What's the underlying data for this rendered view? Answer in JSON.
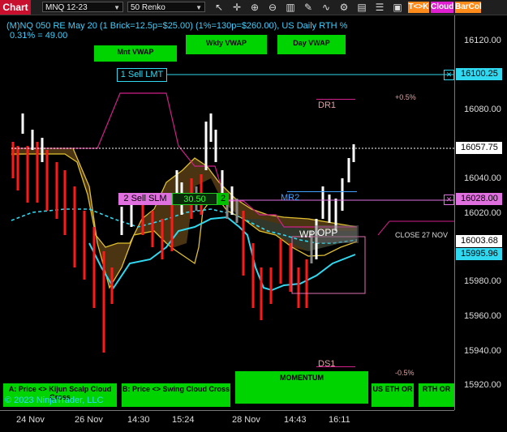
{
  "toolbar": {
    "tab": "Chart",
    "instrument": "MNQ 12-23",
    "bar_type": "50 Renko",
    "buttons": [
      "T<>K",
      "Cloud",
      "BarCol"
    ],
    "colors": {
      "tk": "#ff8c1a",
      "cloud": "#e020d0",
      "barcol": "#ff8c1a"
    },
    "icons": [
      "cursor-icon",
      "crosshair-icon",
      "zoom-in-icon",
      "zoom-out-icon",
      "bar-style-icon",
      "drawing-tools-icon",
      "indicators-icon",
      "strategies-icon",
      "templates-icon",
      "properties-icon",
      "data-box-icon"
    ]
  },
  "header": {
    "title": "(M)NQ 050 RE May 20 (1 Brick=12.5p=$25.00) (1%=130p=$260.00), US Daily RTH %",
    "subtitle": "0.31% = 49.00"
  },
  "vwap": {
    "monthly": "Mnt VWAP",
    "weekly": "Wkly VWAP",
    "daily": "Day VWAP"
  },
  "orders": {
    "sell_lmt": "1 Sell LMT",
    "sell_slm": "2 Sell SLM",
    "pnl": "30.50",
    "qty": "2"
  },
  "chart_labels": {
    "dr1": "DR1",
    "mr2": "MR2",
    "wp": "WP",
    "opp": "OPP",
    "close": "CLOSE 27 NOV",
    "ds1": "DS1",
    "pct_up": "+0.5%",
    "pct_down": "-0.5%"
  },
  "bottom_buttons": {
    "a": "A: Price <> Kijun Scalp Cloud Cross",
    "b": "B: Price <> Swing Cloud Cross",
    "momentum": "MOMENTUM",
    "us_eth": "US ETH OR",
    "rth": "RTH OR"
  },
  "copyright": "© 2023 NinjaTrader, LLC",
  "price_axis": {
    "ticks": [
      "16120.00",
      "16100.25",
      "16080.00",
      "16057.75",
      "16040.00",
      "16028.00",
      "16020.00",
      "16003.68",
      "15995.96",
      "15980.00",
      "15960.00",
      "15940.00",
      "15920.00"
    ],
    "tags": {
      "sell_lmt": "16100.25",
      "last": "16057.75",
      "sell_slm": "16028.00",
      "vwap": "16003.68",
      "cloud": "15995.96"
    }
  },
  "time_axis": [
    "24 Nov",
    "26 Nov",
    "14:30",
    "15:24",
    "28 Nov",
    "14:43",
    "16:11"
  ]
}
